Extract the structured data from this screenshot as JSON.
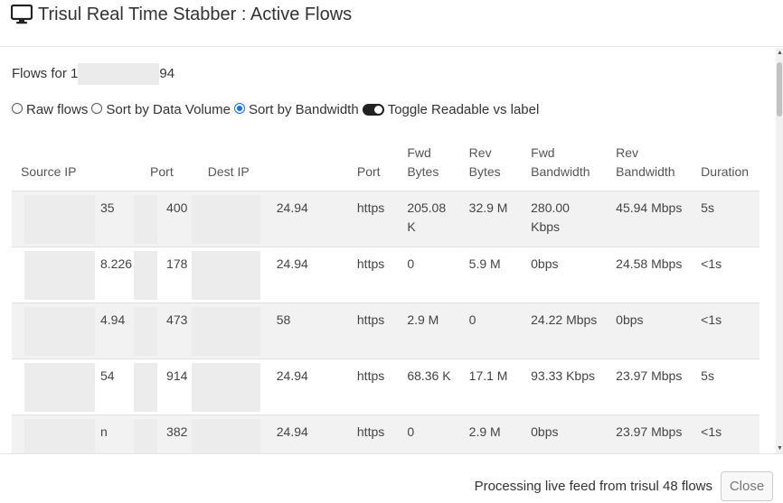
{
  "header": {
    "title": "Trisul Real Time Stabber : Active Flows",
    "icon": "monitor-icon"
  },
  "body": {
    "flows_for_prefix": "Flows for 1",
    "flows_for_suffix": "94",
    "options": {
      "raw_flows": "Raw flows",
      "sort_data_volume": "Sort by Data Volume",
      "sort_bandwidth": "Sort by Bandwidth",
      "toggle_label": "Toggle Readable vs label",
      "selected": "sort_bandwidth"
    },
    "table": {
      "headers": {
        "source_ip": "Source IP",
        "sport": "Port",
        "dest_ip": "Dest IP",
        "dport": "Port",
        "fwd_bytes_1": "Fwd",
        "fwd_bytes_2": "Bytes",
        "rev_bytes_1": "Rev",
        "rev_bytes_2": "Bytes",
        "fwd_bw_1": "Fwd",
        "fwd_bw_2": "Bandwidth",
        "rev_bw_1": "Rev",
        "rev_bw_2": "Bandwidth",
        "duration": "Duration"
      },
      "rows": [
        {
          "src": "35",
          "sport": "400",
          "dst": "24.94",
          "dport": "https",
          "fwd_bytes": "205.08 K",
          "rev_bytes": "32.9 M",
          "fwd_bw": "280.00 Kbps",
          "rev_bw": "45.94 Mbps",
          "duration": "5s"
        },
        {
          "src": "8.226",
          "sport": "178",
          "dst": "24.94",
          "dport": "https",
          "fwd_bytes": "0",
          "rev_bytes": "5.9 M",
          "fwd_bw": "0bps",
          "rev_bw": "24.58 Mbps",
          "duration": "<1s"
        },
        {
          "src": "4.94",
          "sport": "473",
          "dst": "58",
          "dport": "https",
          "fwd_bytes": "2.9 M",
          "rev_bytes": "0",
          "fwd_bw": "24.22 Mbps",
          "rev_bw": "0bps",
          "duration": "<1s"
        },
        {
          "src": "54",
          "sport": "914",
          "dst": "24.94",
          "dport": "https",
          "fwd_bytes": "68.36 K",
          "rev_bytes": "17.1 M",
          "fwd_bw": "93.33 Kbps",
          "rev_bw": "23.97 Mbps",
          "duration": "5s"
        },
        {
          "src": "n",
          "sport": "382",
          "dst": "24.94",
          "dport": "https",
          "fwd_bytes": "0",
          "rev_bytes": "2.9 M",
          "fwd_bw": "0bps",
          "rev_bw": "23.97 Mbps",
          "duration": "<1s"
        }
      ]
    }
  },
  "footer": {
    "status": "Processing live feed from trisul 48 flows",
    "close_label": "Close"
  },
  "colors": {
    "accent": "#0d6efd",
    "stripe": "#f2f2f2"
  }
}
